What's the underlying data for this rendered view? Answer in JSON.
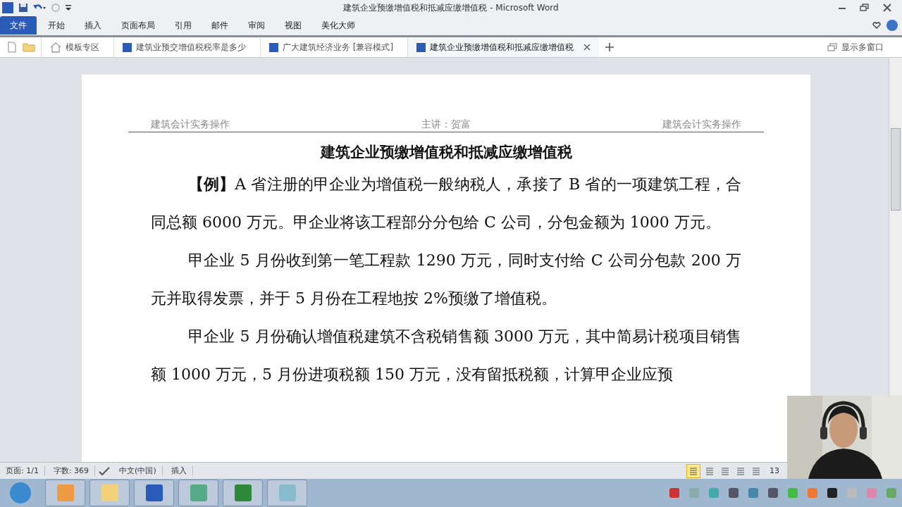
{
  "window": {
    "title": "建筑企业预缴增值税和抵减应缴增值税 - Microsoft Word"
  },
  "ribbon_tabs": [
    {
      "label": "文件",
      "selected": true
    },
    {
      "label": "开始",
      "selected": false
    },
    {
      "label": "插入",
      "selected": false
    },
    {
      "label": "页面布局",
      "selected": false
    },
    {
      "label": "引用",
      "selected": false
    },
    {
      "label": "邮件",
      "selected": false
    },
    {
      "label": "审阅",
      "selected": false
    },
    {
      "label": "视图",
      "selected": false
    },
    {
      "label": "美化大师",
      "selected": false
    }
  ],
  "doc_tabs": [
    {
      "label": "模板专区",
      "kind": "home",
      "selected": false
    },
    {
      "label": "建筑业预交增值税税率是多少",
      "kind": "doc",
      "selected": false
    },
    {
      "label": "广大建筑经济业务 [兼容模式]",
      "kind": "doc",
      "selected": false
    },
    {
      "label": "建筑企业预缴增值税和抵减应缴增值税",
      "kind": "doc",
      "selected": true
    }
  ],
  "multi_window": "显示多窗口",
  "document": {
    "header": {
      "left": "建筑会计实务操作",
      "center": "主讲：贺富",
      "right": "建筑会计实务操作"
    },
    "heading": "建筑企业预缴增值税和抵减应缴增值税",
    "paragraphs": [
      "**【例】**A 省注册的甲企业为增值税一般纳税人，承接了 B 省的一项建筑工程，合同总额 6000 万元。甲企业将该工程部分分包给 C 公司，分包金额为 1000 万元。",
      "甲企业 5 月份收到第一笔工程款 1290 万元，同时支付给 C 公司分包款 200 万元并取得发票，并于 5 月份在工程地按 2%预缴了增值税。",
      "甲企业 5 月份确认增值税建筑不含税销售额 3000 万元，其中简易计税项目销售额 1000 万元，5 月份进项税额 150 万元，没有留抵税额，计算甲企业应预"
    ]
  },
  "status_bar": {
    "page": "页面: 1/1",
    "words": "字数: 369",
    "language": "中文(中国)",
    "mode": "插入",
    "zoom": "13",
    "view_modes": [
      {
        "selected": true
      },
      {
        "selected": false
      },
      {
        "selected": false
      },
      {
        "selected": false
      },
      {
        "selected": false
      }
    ]
  }
}
